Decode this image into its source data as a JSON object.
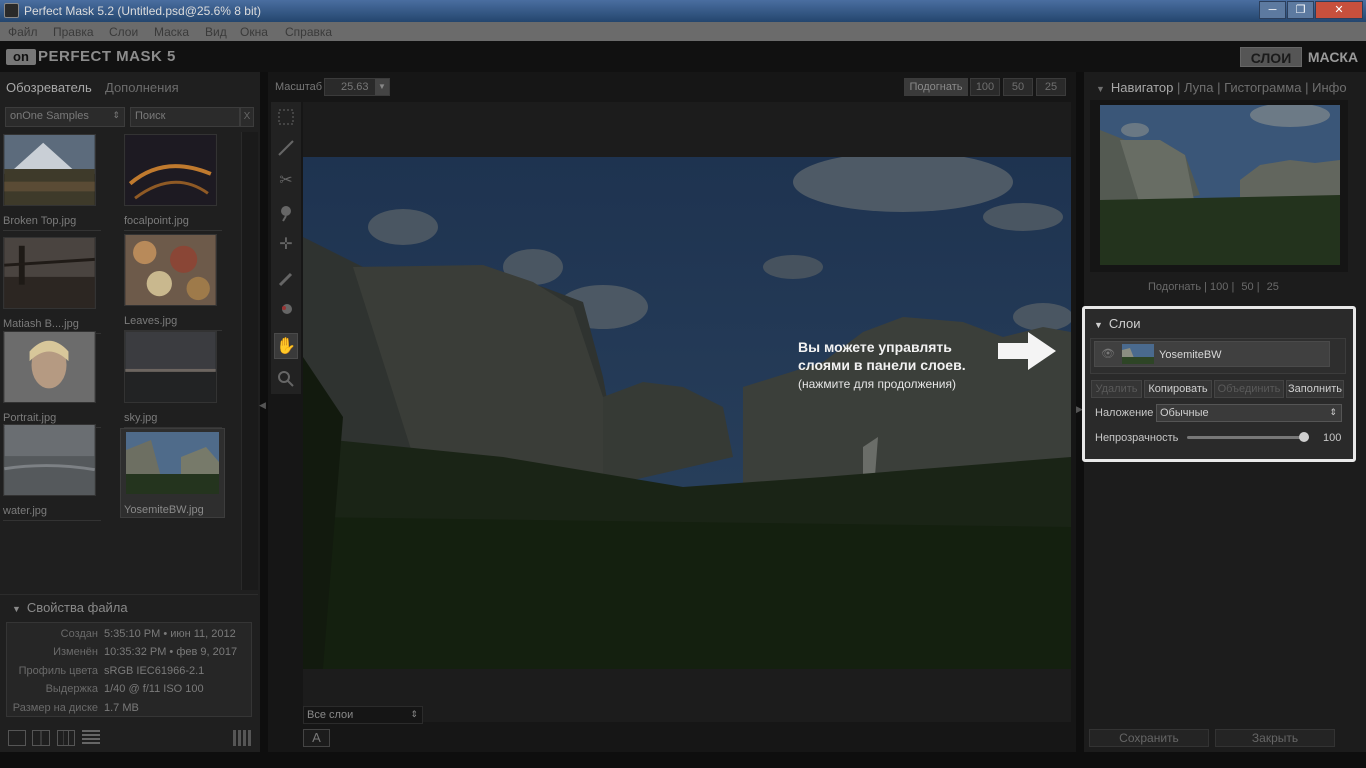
{
  "window": {
    "title": "Perfect Mask 5.2 (Untitled.psd@25.6% 8 bit)",
    "controls": [
      "─",
      "❐",
      "✕"
    ]
  },
  "menu": [
    "Файл",
    "Правка",
    "Слои",
    "Маска",
    "Вид",
    "Окна",
    "Справка"
  ],
  "brand": {
    "logo_mark": "on",
    "name": "PERFECT MASK 5"
  },
  "modes": {
    "layers": "СЛОИ",
    "mask": "МАСКА"
  },
  "left": {
    "tabs": [
      "Обозреватель",
      "Дополнения"
    ],
    "source": "onOne Samples",
    "search_placeholder": "Поиск",
    "search_clear": "X",
    "thumbnails": [
      {
        "label": "Broken Top.jpg"
      },
      {
        "label": "focalpoint.jpg"
      },
      {
        "label": "Matiash B....jpg"
      },
      {
        "label": "Leaves.jpg"
      },
      {
        "label": "Portrait.jpg"
      },
      {
        "label": "sky.jpg"
      },
      {
        "label": "water.jpg"
      },
      {
        "label": "YosemiteBW.jpg"
      }
    ],
    "properties_title": "Свойства файла",
    "properties": [
      {
        "k": "Создан",
        "v": "5:35:10 PM • июн 11, 2012"
      },
      {
        "k": "Изменён",
        "v": "10:35:32 PM • фев 9, 2017"
      },
      {
        "k": "Профиль цвета",
        "v": "sRGB IEC61966-2.1"
      },
      {
        "k": "Выдержка",
        "v": "1/40 @ f/11  ISO 100"
      },
      {
        "k": "Размер на диске",
        "v": "1.7 MB"
      }
    ]
  },
  "center": {
    "zoom_label": "Масштаб",
    "zoom_value": "25.63",
    "fit_buttons": [
      "Подогнать",
      "100",
      "50",
      "25"
    ],
    "layers_select": "Все слои",
    "a_button": "A",
    "callout": {
      "line1": "Вы можете управлять",
      "line2": "слоями в панели слоев.",
      "hint": "(нажмите для продолжения)"
    }
  },
  "right": {
    "nav_tabs": [
      "Навигатор",
      "Лупа",
      "Гистограмма",
      "Инфо"
    ],
    "nav_zoom": [
      "Подогнать",
      "100",
      "50",
      "25"
    ],
    "layers_title": "Слои",
    "layer_name": "YosemiteBW",
    "layer_buttons": [
      "Удалить",
      "Копировать",
      "Объединить",
      "Заполнить"
    ],
    "blend_label": "Наложение",
    "blend_value": "Обычные",
    "opacity_label": "Непрозрачность",
    "opacity_value": "100",
    "save": "Сохранить",
    "close": "Закрыть"
  }
}
